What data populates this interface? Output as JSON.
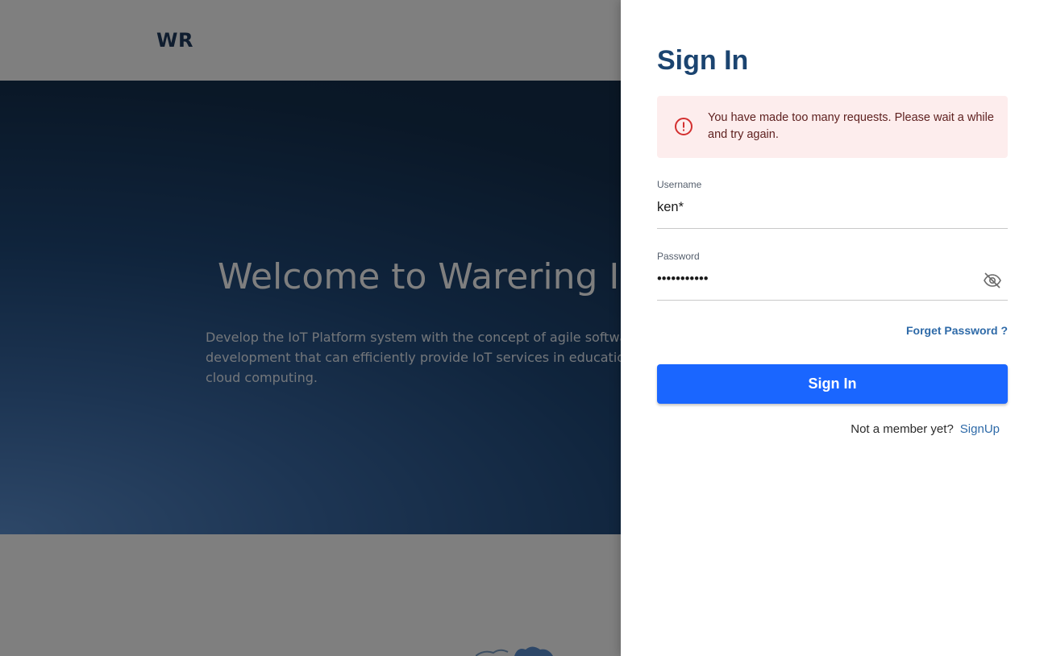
{
  "landing": {
    "logo": "WR",
    "hero_title": "Welcome to Warering IoT",
    "hero_description": "Develop the IoT Platform system with the concept of agile software development that can efficiently provide IoT services in education through cloud computing."
  },
  "signin": {
    "title": "Sign In",
    "alert_message": "You have made too many requests. Please wait a while and try again.",
    "username_label": "Username",
    "username_value": "ken*",
    "password_label": "Password",
    "password_value": "mypassword1",
    "forget_password": "Forget Password ?",
    "submit_label": "Sign In",
    "not_member_text": "Not a member yet?",
    "signup_link": "SignUp"
  },
  "colors": {
    "primary": "#1a66ff",
    "title": "#1b4470",
    "link": "#2e6aa8",
    "error_bg": "#fdeded",
    "error_icon": "#d32f2f"
  }
}
